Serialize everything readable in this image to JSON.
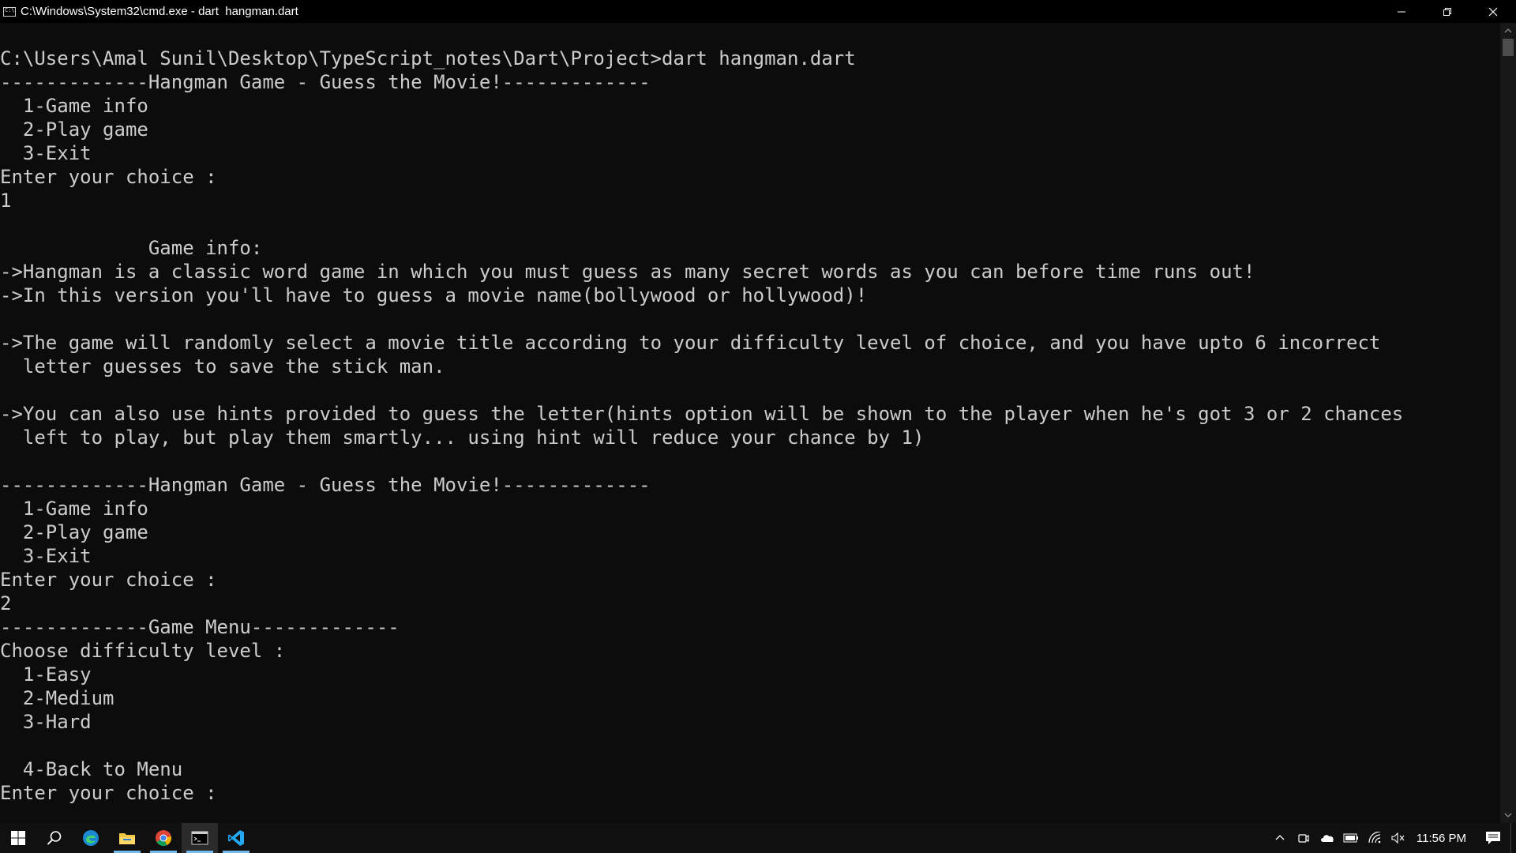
{
  "window": {
    "title": "C:\\Windows\\System32\\cmd.exe - dart  hangman.dart",
    "controls": {
      "minimize_icon": "minimize-icon",
      "restore_icon": "restore-icon",
      "close_icon": "close-icon"
    }
  },
  "terminal": {
    "colors": {
      "background": "#0c0c0c",
      "foreground": "#cccccc"
    },
    "output": "C:\\Users\\Amal Sunil\\Desktop\\TypeScript_notes\\Dart\\Project>dart hangman.dart\n-------------Hangman Game - Guess the Movie!-------------\n  1-Game info\n  2-Play game\n  3-Exit\nEnter your choice :\n1\n\n             Game info:\n->Hangman is a classic word game in which you must guess as many secret words as you can before time runs out!\n->In this version you'll have to guess a movie name(bollywood or hollywood)!\n\n->The game will randomly select a movie title according to your difficulty level of choice, and you have upto 6 incorrect\n  letter guesses to save the stick man.\n\n->You can also use hints provided to guess the letter(hints option will be shown to the player when he's got 3 or 2 chances\n  left to play, but play them smartly... using hint will reduce your chance by 1)\n\n-------------Hangman Game - Guess the Movie!-------------\n  1-Game info\n  2-Play game\n  3-Exit\nEnter your choice :\n2\n-------------Game Menu-------------\nChoose difficulty level :\n  1-Easy\n  2-Medium\n  3-Hard\n\n  4-Back to Menu\nEnter your choice :"
  },
  "taskbar": {
    "apps": [
      {
        "name": "start-button",
        "icon": "windows-logo-icon"
      },
      {
        "name": "search-button",
        "icon": "search-icon"
      },
      {
        "name": "edge-app",
        "icon": "edge-icon"
      },
      {
        "name": "file-explorer-app",
        "icon": "folder-icon"
      },
      {
        "name": "chrome-app",
        "icon": "chrome-icon"
      },
      {
        "name": "cmd-app",
        "icon": "terminal-icon"
      },
      {
        "name": "vscode-app",
        "icon": "vscode-icon"
      }
    ],
    "tray": {
      "icons": [
        "chevron-up-icon",
        "meet-now-icon",
        "onedrive-icon",
        "battery-icon",
        "wifi-icon",
        "volume-muted-icon"
      ],
      "time": "11:56 PM",
      "notification_icon": "notification-icon"
    }
  }
}
